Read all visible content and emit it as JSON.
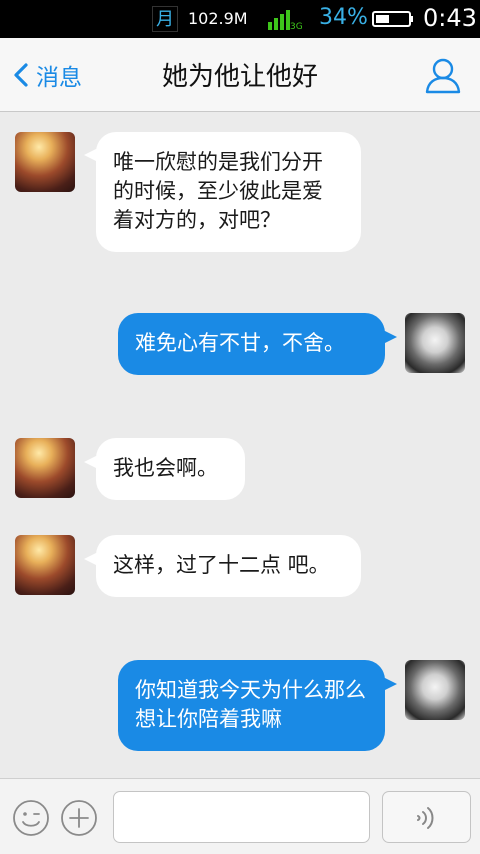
{
  "status_bar": {
    "moon_glyph": "月",
    "net_speed": "102.9M",
    "network_type": "3G",
    "battery_percent": "34%",
    "time": "0:43"
  },
  "nav": {
    "back_label": "消息",
    "title": "她为他让他好"
  },
  "messages": [
    {
      "side": "left",
      "text": "唯一欣慰的是我们分开的时候，至少彼此是爱着对方的，对吧？"
    },
    {
      "side": "right",
      "text": "难免心有不甘，不舍。"
    },
    {
      "side": "left",
      "text": "我也会啊。"
    },
    {
      "side": "left",
      "text": "这样，过了十二点  吧。"
    },
    {
      "side": "right",
      "text": "你知道我今天为什么那么想让你陪着我嘛"
    }
  ],
  "input_bar": {
    "input_value": ""
  },
  "colors": {
    "accent": "#1a8ae5",
    "chat_background": "#ebebeb",
    "bubble_left": "#ffffff",
    "bubble_right": "#1a8ae5"
  }
}
